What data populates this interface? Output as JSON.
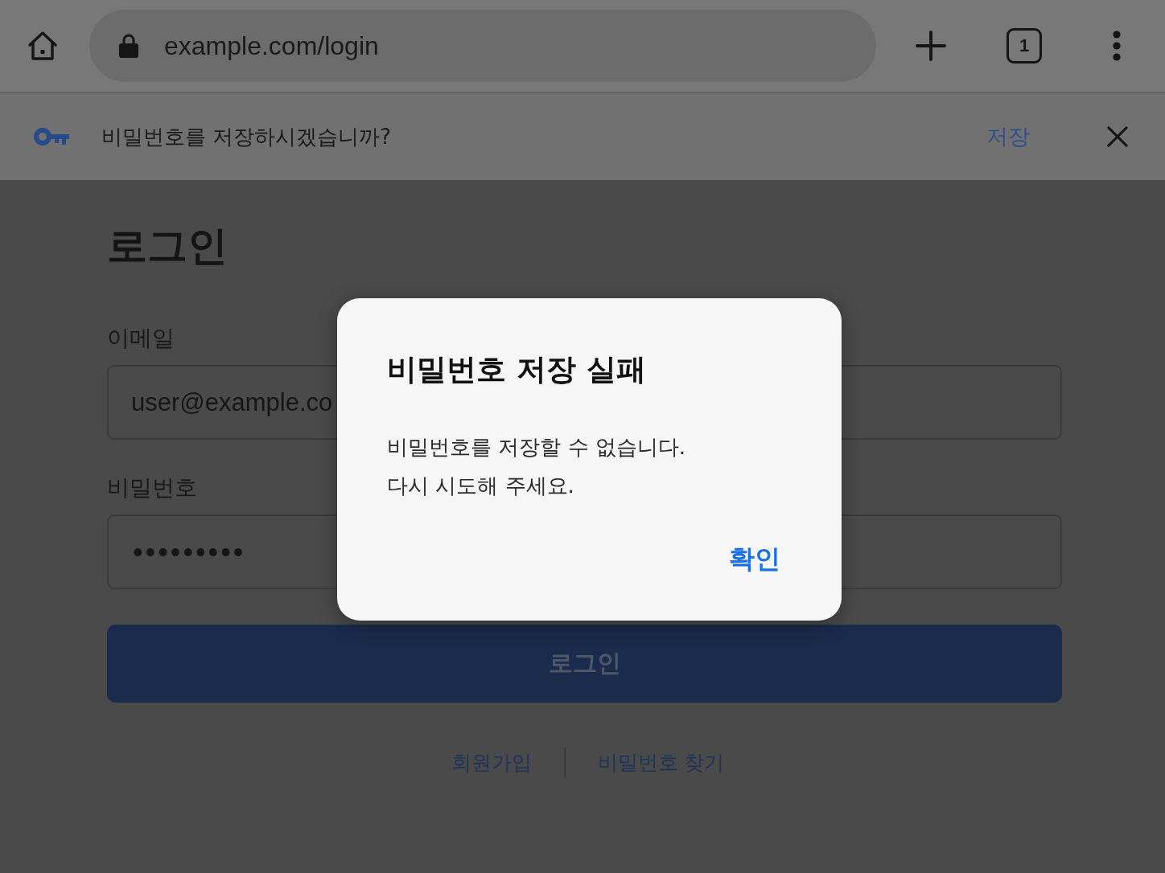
{
  "browser_toolbar": {
    "url": "example.com/login",
    "tab_count": "1"
  },
  "save_password_bar": {
    "message": "비밀번호를 저장하시겠습니까?",
    "save_label": "저장"
  },
  "login_form": {
    "title": "로그인",
    "fields": [
      {
        "label": "이메일",
        "kind": "text",
        "value": "user@example.co"
      },
      {
        "label": "비밀번호",
        "kind": "password",
        "value": "•••••••••"
      }
    ],
    "submit_label": "로그인",
    "links": [
      "회원가입",
      "비밀번호 찾기"
    ]
  },
  "dialog": {
    "title": "비밀번호 저장 실패",
    "message_lines": [
      "비밀번호를 저장할 수 없습니다.",
      "다시 시도해 주세요."
    ],
    "confirm_label": "확인"
  }
}
